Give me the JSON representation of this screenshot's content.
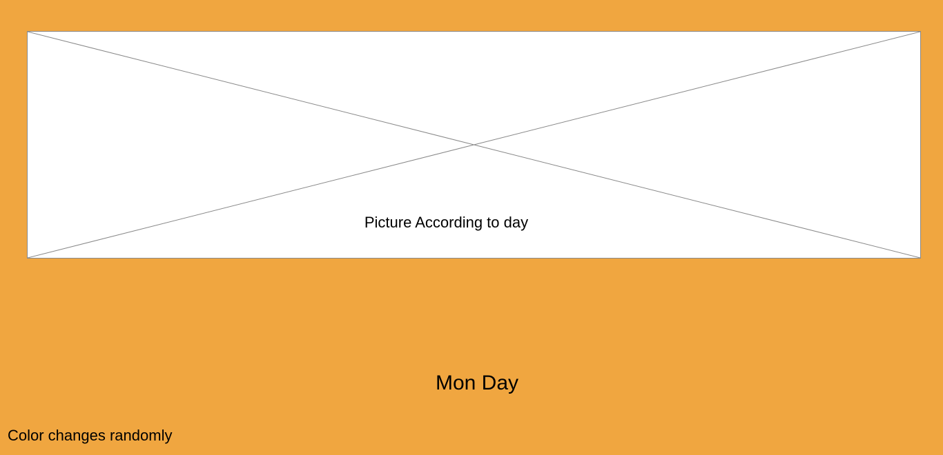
{
  "picture": {
    "caption": "Picture According to day"
  },
  "day": {
    "label": "Mon Day"
  },
  "footer": {
    "note": "Color changes randomly"
  },
  "colors": {
    "background": "#f0a640",
    "picture_background": "#ffffff",
    "picture_border": "#888888"
  }
}
